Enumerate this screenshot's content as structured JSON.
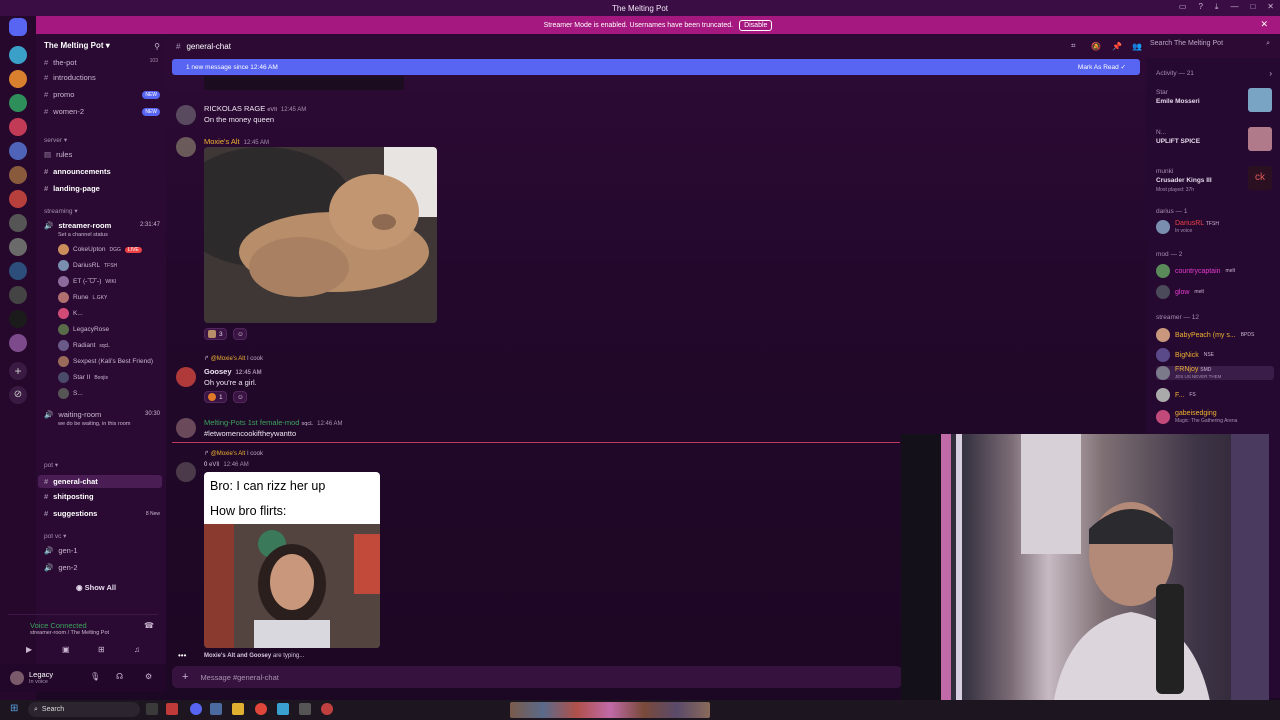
{
  "window": {
    "title": "The Melting Pot"
  },
  "banner": {
    "text": "Streamer Mode is enabled. Usernames have been truncated.",
    "button": "Disable"
  },
  "server": {
    "name": "The Melting Pot"
  },
  "sidebar": {
    "items": [
      {
        "label": "the-pot",
        "extra": "103"
      },
      {
        "label": "introductions"
      },
      {
        "label": "promo",
        "badge": "NEW"
      },
      {
        "label": "women-2",
        "badge": "NEW"
      },
      {
        "label": "server",
        "type": "category"
      },
      {
        "label": "rules"
      },
      {
        "label": "announcements",
        "bold": true
      },
      {
        "label": "landing-page",
        "bold": true
      },
      {
        "label": "streaming",
        "type": "category"
      },
      {
        "label": "streamer-room",
        "bold": true,
        "extra": "2:31:47"
      },
      {
        "label": "Set a channel status"
      },
      {
        "label": "waiting-room",
        "extra": "30:30"
      },
      {
        "label": "we do be waiting, in this room"
      },
      {
        "label": "pot",
        "type": "category"
      },
      {
        "label": "general-chat",
        "bold": true
      },
      {
        "label": "shitposting",
        "bold": true
      },
      {
        "label": "suggestions",
        "bold": true,
        "extra": "8 New"
      },
      {
        "label": "pot vc",
        "type": "category"
      },
      {
        "label": "gen-1"
      },
      {
        "label": "gen-2"
      }
    ],
    "voice_users": [
      "CokeUpton",
      "DariusRL",
      "ET (˶ˆᗜˆ˵)",
      "Rune",
      "K...",
      "LegacyRose",
      "Radiant",
      "Sexpest (Kali's Best Friend)",
      "Star II",
      "S..."
    ],
    "voice_tags": [
      "DGG",
      "TFSH",
      "WIKI",
      "L.GKY",
      "",
      "",
      "sqcL",
      "",
      "Boojis",
      ""
    ],
    "live_label": "LIVE",
    "show_all": "Show All"
  },
  "voice_panel": {
    "status": "Voice Connected",
    "location": "streamer-room / The Melting Pot"
  },
  "user_panel": {
    "name": "Legacy",
    "status": "In voice"
  },
  "channel": {
    "name": "general-chat"
  },
  "new_messages": {
    "text": "1 new message since 12:46 AM",
    "action": "Mark As Read"
  },
  "search": {
    "placeholder": "Search The Melting Pot"
  },
  "messages": [
    {
      "author": "RICKOLAS RAGE",
      "tag": "eVIl",
      "time": "12:45 AM",
      "text": "On the money queen"
    },
    {
      "author": "Moxie's Alt",
      "time": "12:45 AM",
      "reaction_count": "3"
    },
    {
      "reply_to": "@Moxie's Alt",
      "reply_text": "I cook",
      "author": "Goosey",
      "time": "12:45 AM",
      "text": "Oh you're a girl.",
      "reaction_count": "1"
    },
    {
      "author": "Melting-Pots 1st female-mod",
      "tag": "sqcL",
      "time": "12:46 AM",
      "text": "#letwomencookiftheywantto"
    },
    {
      "reply_to": "@Moxie's Alt",
      "reply_text": "I cook",
      "author": "0",
      "tag": "eVIl",
      "time": "12:46 AM"
    }
  ],
  "meme": {
    "line1": "Bro: I can rizz her up",
    "line2": "How bro flirts:"
  },
  "typing": {
    "names": "Moxie's Alt and Goosey",
    "suffix": "are typing..."
  },
  "composer": {
    "placeholder": "Message #general-chat"
  },
  "members": {
    "activity_header": "Activity — 21",
    "activities": [
      {
        "name": "Star",
        "detail": "Emile Mosseri"
      },
      {
        "name": "N...",
        "detail": "UPLIFT SPICE"
      },
      {
        "name": "munki",
        "detail": "Crusader Kings III",
        "sub": "Most played: 37h"
      }
    ],
    "sections": [
      {
        "title": "darius — 1",
        "users": [
          {
            "name": "DariusRL",
            "tag": "TFSH",
            "status": "In voice",
            "color": "#ed4245"
          }
        ]
      },
      {
        "title": "mod — 2",
        "users": [
          {
            "name": "countrycaptain",
            "tag": "melt",
            "color": "#e93bd0"
          },
          {
            "name": "glow",
            "tag": "melt",
            "color": "#e93bd0"
          }
        ]
      },
      {
        "title": "streamer — 12",
        "users": [
          {
            "name": "BabyPeach (my s...",
            "tag": "BPDS",
            "color": "#f0b232"
          },
          {
            "name": "BigNick",
            "tag": "NSE",
            "color": "#f0b232"
          },
          {
            "name": "FRNjoy",
            "tag": "SMD",
            "status": "JES US NEVER THEM",
            "color": "#f0b232"
          },
          {
            "name": "F...",
            "tag": "FS",
            "color": "#f0b232"
          },
          {
            "name": "gabeisedging",
            "status": "Magic: The Gathering Arena",
            "color": "#f0b232"
          }
        ]
      }
    ]
  },
  "taskbar": {
    "search": "Search"
  },
  "colors": {
    "accent": "#5865f2",
    "banner": "#a5187f",
    "live": "#ed4245"
  }
}
